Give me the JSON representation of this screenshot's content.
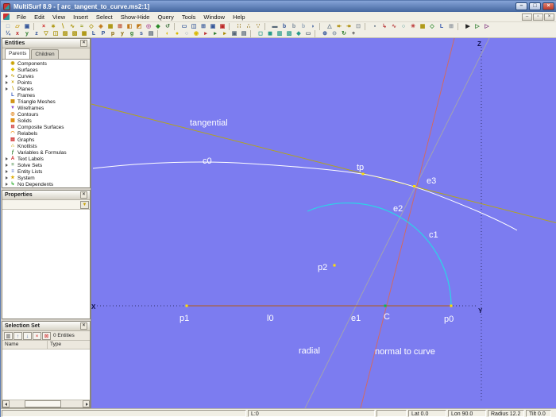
{
  "window": {
    "title": "MultiSurf 8.9 - [ arc_tangent_to_curve.ms2:1]",
    "controls": [
      {
        "name": "minimize-button",
        "glyph": "–"
      },
      {
        "name": "maximize-button",
        "glyph": "□"
      },
      {
        "name": "close-button",
        "glyph": "×",
        "cls": "close"
      }
    ]
  },
  "menu": {
    "items": [
      "File",
      "Edit",
      "View",
      "Insert",
      "Select",
      "Show-Hide",
      "Query",
      "Tools",
      "Window",
      "Help"
    ],
    "mdi_controls": [
      {
        "name": "mdi-minimize-button",
        "glyph": "–"
      },
      {
        "name": "mdi-restore-button",
        "glyph": "▫"
      },
      {
        "name": "mdi-close-button",
        "glyph": "×"
      }
    ]
  },
  "toolbar_row1": [
    {
      "name": "new-file-icon",
      "glyph": "□",
      "color": "#6688bb"
    },
    {
      "name": "open-folder-icon",
      "glyph": "▱",
      "color": "#c79a10"
    },
    {
      "name": "save-icon",
      "glyph": "▣",
      "color": "#335599"
    },
    {
      "name": "toolbar-separator",
      "cls": "tb-sep",
      "interactable": false
    },
    {
      "name": "delete-icon",
      "glyph": "×",
      "color": "#cc2222"
    },
    {
      "name": "insert-point-icon",
      "glyph": "∗",
      "color": "#a89000"
    },
    {
      "name": "insert-line-icon",
      "glyph": "∖",
      "color": "#a89000"
    },
    {
      "name": "insert-curve-icon",
      "glyph": "∿",
      "color": "#a89000"
    },
    {
      "name": "insert-snake-icon",
      "glyph": "≈",
      "color": "#889000"
    },
    {
      "name": "insert-surface-icon",
      "glyph": "◇",
      "color": "#a89000"
    },
    {
      "name": "insert-solid-icon",
      "glyph": "◈",
      "color": "#c07818"
    },
    {
      "name": "insert-mesh-icon",
      "glyph": "▦",
      "color": "#a89000"
    },
    {
      "name": "insert-composite-icon",
      "glyph": "⊞",
      "color": "#bb4422"
    },
    {
      "name": "insert-cube-icon",
      "glyph": "◧",
      "color": "#c07818"
    },
    {
      "name": "insert-prism-icon",
      "glyph": "◩",
      "color": "#c07818"
    },
    {
      "name": "insert-sphere-icon",
      "glyph": "◎",
      "color": "#b05599"
    },
    {
      "name": "magnet-icon",
      "glyph": "◆",
      "color": "#2a8a2a"
    },
    {
      "name": "undo-icon",
      "glyph": "↺",
      "color": "#447744"
    },
    {
      "name": "toolbar-separator",
      "cls": "tb-sep",
      "interactable": false
    },
    {
      "name": "view-wide-icon",
      "glyph": "▭",
      "color": "#335599"
    },
    {
      "name": "view-split-icon",
      "glyph": "◫",
      "color": "#335599"
    },
    {
      "name": "view-quad-icon",
      "glyph": "⊞",
      "color": "#335599"
    },
    {
      "name": "view-single-icon",
      "glyph": "▣",
      "color": "#335599"
    },
    {
      "name": "view-active-icon",
      "glyph": "▣",
      "color": "#bb2222"
    },
    {
      "name": "toolbar-separator",
      "cls": "tb-sep",
      "interactable": false
    },
    {
      "name": "snap-grid-icon",
      "glyph": "∷",
      "color": "#886600"
    },
    {
      "name": "snap-point-icon",
      "glyph": "∴",
      "color": "#886600"
    },
    {
      "name": "snap-ortho-icon",
      "glyph": "∵",
      "color": "#886600"
    },
    {
      "name": "toolbar-separator",
      "cls": "tb-sep",
      "interactable": false
    },
    {
      "name": "measure-icon",
      "glyph": "▬",
      "color": "#556677"
    },
    {
      "name": "label-large-icon",
      "glyph": "b",
      "color": "#335599"
    },
    {
      "name": "label-medium-icon",
      "glyph": "b",
      "color": "#778899"
    },
    {
      "name": "label-small-icon",
      "glyph": "b",
      "color": "#99aabb"
    },
    {
      "name": "comment-icon",
      "glyph": "◗",
      "color": "#335599"
    },
    {
      "name": "toolbar-separator",
      "cls": "tb-sep",
      "interactable": false
    },
    {
      "name": "triangle-icon",
      "glyph": "△",
      "color": "#667788"
    },
    {
      "name": "step-back-icon",
      "glyph": "↞",
      "color": "#aa8800"
    },
    {
      "name": "step-forward-icon",
      "glyph": "↠",
      "color": "#aa8800"
    },
    {
      "name": "stop-icon",
      "glyph": "⊡",
      "color": "#889099"
    },
    {
      "name": "toolbar-separator",
      "cls": "tb-sep",
      "interactable": false
    },
    {
      "name": "ruler-icon",
      "glyph": "▪",
      "color": "#667788"
    },
    {
      "name": "hook-icon",
      "glyph": "↳",
      "color": "#bb4444"
    },
    {
      "name": "wave-icon",
      "glyph": "∿",
      "color": "#bb4444"
    },
    {
      "name": "ring-icon",
      "glyph": "○",
      "color": "#338888"
    },
    {
      "name": "rosette-icon",
      "glyph": "✳",
      "color": "#bb3333"
    },
    {
      "name": "mesh-tool-icon",
      "glyph": "▦",
      "color": "#a89000"
    },
    {
      "name": "diamond-tool-icon",
      "glyph": "◇",
      "color": "#2a8a2a"
    },
    {
      "name": "frame-tool-icon",
      "glyph": "L",
      "color": "#3355aa"
    },
    {
      "name": "grid-tool-icon",
      "glyph": "⊞",
      "color": "#889099"
    },
    {
      "name": "toolbar-separator",
      "cls": "tb-sep",
      "interactable": false
    },
    {
      "name": "select-arrow-icon",
      "glyph": "▶",
      "color": "#222222"
    },
    {
      "name": "select-add-icon",
      "glyph": "▷",
      "color": "#2a7a2a"
    },
    {
      "name": "select-toggle-icon",
      "glyph": "▷",
      "color": "#7a2a7a"
    }
  ],
  "toolbar_row2": [
    {
      "name": "fraction-icon",
      "glyph": "¼",
      "color": "#335599"
    },
    {
      "name": "x-axis-toggle-icon",
      "glyph": "x",
      "color": "#bb2222"
    },
    {
      "name": "y-axis-toggle-icon",
      "glyph": "y",
      "color": "#2a7a2a"
    },
    {
      "name": "z-axis-toggle-icon",
      "glyph": "z",
      "color": "#335599"
    },
    {
      "name": "funnel-icon",
      "glyph": "▽",
      "color": "#a89000"
    },
    {
      "name": "beaker-icon",
      "glyph": "◫",
      "color": "#a89000"
    },
    {
      "name": "hatch-x-icon",
      "glyph": "▨",
      "color": "#a89000"
    },
    {
      "name": "hatch-y-icon",
      "glyph": "▧",
      "color": "#a89000"
    },
    {
      "name": "hatch-z-icon",
      "glyph": "▦",
      "color": "#a89000"
    },
    {
      "name": "corner-icon",
      "glyph": "Ŀ",
      "color": "#335599"
    },
    {
      "name": "pin-P-icon",
      "glyph": "P",
      "color": "#335599"
    },
    {
      "name": "pin-p-icon",
      "glyph": "p",
      "color": "#886600"
    },
    {
      "name": "pin-y-icon",
      "glyph": "y",
      "color": "#886600"
    },
    {
      "name": "pin-g-icon",
      "glyph": "g",
      "color": "#2a7a2a"
    },
    {
      "name": "pin-s-icon",
      "glyph": "s",
      "color": "#335599"
    },
    {
      "name": "print-icon",
      "glyph": "▤",
      "color": "#556677"
    },
    {
      "name": "toolbar-separator",
      "cls": "tb-sep",
      "interactable": false
    },
    {
      "name": "show-hide-icon",
      "glyph": "◐",
      "color": "#d8b800"
    },
    {
      "name": "bulb-on-icon",
      "glyph": "●",
      "color": "#d8b800"
    },
    {
      "name": "bulb-off-icon",
      "glyph": "○",
      "color": "#8899aa"
    },
    {
      "name": "bulb-blink-icon",
      "glyph": "◉",
      "color": "#d8b800"
    },
    {
      "name": "flag-red-icon",
      "glyph": "▸",
      "color": "#bb3333"
    },
    {
      "name": "flag-green-icon",
      "glyph": "▸",
      "color": "#2a7a2a"
    },
    {
      "name": "flag-yellow-icon",
      "glyph": "▸",
      "color": "#aa8800"
    },
    {
      "name": "camera-icon",
      "glyph": "▣",
      "color": "#556677"
    },
    {
      "name": "note-icon",
      "glyph": "▤",
      "color": "#556677"
    },
    {
      "name": "toolbar-separator",
      "cls": "tb-sep",
      "interactable": false
    },
    {
      "name": "wireframe-mode-icon",
      "glyph": "◻",
      "color": "#2a9a8a"
    },
    {
      "name": "shaded-mode-icon",
      "glyph": "◼",
      "color": "#2a9a8a"
    },
    {
      "name": "render-hidden-icon",
      "glyph": "▥",
      "color": "#2a9a8a"
    },
    {
      "name": "render-textured-icon",
      "glyph": "▧",
      "color": "#2a9a8a"
    },
    {
      "name": "render-solid-icon",
      "glyph": "◆",
      "color": "#2a9a8a"
    },
    {
      "name": "mail-view-icon",
      "glyph": "▭",
      "color": "#556677"
    },
    {
      "name": "toolbar-separator",
      "cls": "tb-sep",
      "interactable": false
    },
    {
      "name": "zoom-in-icon",
      "glyph": "⊕",
      "color": "#335599"
    },
    {
      "name": "zoom-out-icon",
      "glyph": "⊖",
      "color": "#8899aa"
    },
    {
      "name": "rotate-view-icon",
      "glyph": "↻",
      "color": "#2a7a2a"
    },
    {
      "name": "pan-icon",
      "glyph": "+",
      "color": "#333333"
    }
  ],
  "entities_panel": {
    "title": "Entities",
    "close_glyph": "×",
    "tabs": [
      {
        "label": "Parents",
        "cls": "active"
      },
      {
        "label": "Children"
      }
    ],
    "items": [
      {
        "label": "Components",
        "glyph": "◉",
        "color": "#c8a000"
      },
      {
        "label": "Surfaces",
        "glyph": "◆",
        "color": "#e0c000"
      },
      {
        "label": "Curves",
        "glyph": "∿",
        "color": "#c8a000",
        "cls": "expandable"
      },
      {
        "label": "Points",
        "glyph": "×",
        "color": "#c8a000",
        "cls": "expandable"
      },
      {
        "label": "Planes",
        "glyph": "∖",
        "color": "#c8a000",
        "cls": "expandable"
      },
      {
        "label": "Frames",
        "glyph": "L",
        "color": "#3355bb"
      },
      {
        "label": "Triangle Meshes",
        "glyph": "▦",
        "color": "#cc8800"
      },
      {
        "label": "Wireframes",
        "glyph": "▼",
        "color": "#8844cc"
      },
      {
        "label": "Contours",
        "glyph": "◎",
        "color": "#dd7700"
      },
      {
        "label": "Solids",
        "glyph": "▩",
        "color": "#dd8800"
      },
      {
        "label": "Composite Surfaces",
        "glyph": "⊞",
        "color": "#cc3333"
      },
      {
        "label": "Relabels",
        "glyph": "◠",
        "color": "#ee8800"
      },
      {
        "label": "Graphs",
        "glyph": "▤",
        "color": "#cc2222"
      },
      {
        "label": "Knotlists",
        "glyph": "∴",
        "color": "#c8a000"
      },
      {
        "label": "Variables & Formulas",
        "glyph": "ƒ",
        "color": "#2a7a2a"
      },
      {
        "label": "Text Labels",
        "glyph": "A",
        "color": "#cc2222",
        "cls": "expandable"
      },
      {
        "label": "Solve Sets",
        "glyph": "=",
        "color": "#2a7a2a",
        "cls": "expandable"
      },
      {
        "label": "Entity Lists",
        "glyph": "≡",
        "color": "#3355bb",
        "cls": "expandable"
      },
      {
        "label": "System",
        "glyph": "★",
        "color": "#ddaa00",
        "cls": "expandable"
      },
      {
        "label": "No Dependents",
        "glyph": "↳",
        "color": "#22aa22",
        "cls": "expandable"
      }
    ]
  },
  "properties_panel": {
    "title": "Properties",
    "close_glyph": "×",
    "filter_glyph": "▼"
  },
  "selection_panel": {
    "title": "Selection Set",
    "close_glyph": "×",
    "toolbar": [
      {
        "name": "columns-icon",
        "glyph": "▥",
        "color": "#444444"
      },
      {
        "name": "move-up-icon",
        "glyph": "↑",
        "color": "#335599"
      },
      {
        "name": "move-down-icon",
        "glyph": "↓",
        "color": "#335599"
      },
      {
        "name": "remove-icon",
        "glyph": "×",
        "color": "#cc2222"
      },
      {
        "name": "remove-all-icon",
        "glyph": "⊠",
        "color": "#cc2222"
      }
    ],
    "count_label": "0 Entities",
    "columns": [
      "Name",
      "Type"
    ]
  },
  "statusbar": {
    "fields": [
      "",
      "L:0",
      "",
      "Lat 0.0",
      "Lon 90.0",
      "Radius 12.2",
      "Tilt 0.0"
    ]
  },
  "canvas": {
    "background": "#7c7cf0",
    "labels": {
      "tangential": "tangential",
      "c0": "c0",
      "tp": "tp",
      "e3": "e3",
      "e2": "e2",
      "c1": "c1",
      "p2": "p2",
      "p1": "p1",
      "l0": "l0",
      "e1": "e1",
      "C": "C",
      "p0": "p0",
      "radial": "radial",
      "normal": "normal to curve",
      "x_axis": "X",
      "y_axis": "Y",
      "z_axis": "Z"
    },
    "colors": {
      "tangential_line": "#b3a41e",
      "normal_line": "#d06a64",
      "radial_line": "#a2a2b0",
      "curve_c0": "#ffffff",
      "arc_c1": "#2cd4e6",
      "line_l0": "#b45a14",
      "axis_dotted": "#32326e",
      "point_yellow": "#ffe000",
      "point_green": "#00c050",
      "label_text": "#ffffff",
      "axis_text": "#10104a"
    }
  }
}
